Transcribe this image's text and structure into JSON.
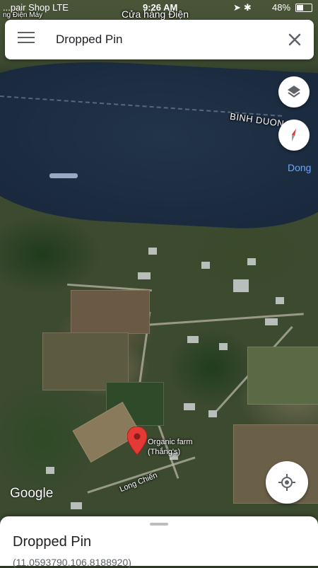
{
  "status_bar": {
    "carrier": "...pair Shop  LTE",
    "time": "9:26 AM",
    "battery": "48%"
  },
  "search_bar": {
    "title": "Dropped Pin",
    "menu_icon": "hamburger-menu-icon",
    "close_icon": "close-icon"
  },
  "map": {
    "top_labels": [
      "Cửa hàng Điện",
      "ng Điện Máy"
    ],
    "region_label": "BINH DUON",
    "blue_label": "Dong",
    "place_name": "Organic farm",
    "place_sub": "(Thắng's)",
    "road_label": "Long Chiến",
    "logo": "Google"
  },
  "controls": {
    "layers_icon": "layers-icon",
    "compass_icon": "compass-icon",
    "location_icon": "my-location-icon"
  },
  "bottom_sheet": {
    "title": "Dropped Pin",
    "coordinates": "(11.0593790,106.8188920)"
  },
  "colors": {
    "pin": "#e53935",
    "compass_red": "#e53935",
    "blue_label": "#6aa7ff"
  }
}
